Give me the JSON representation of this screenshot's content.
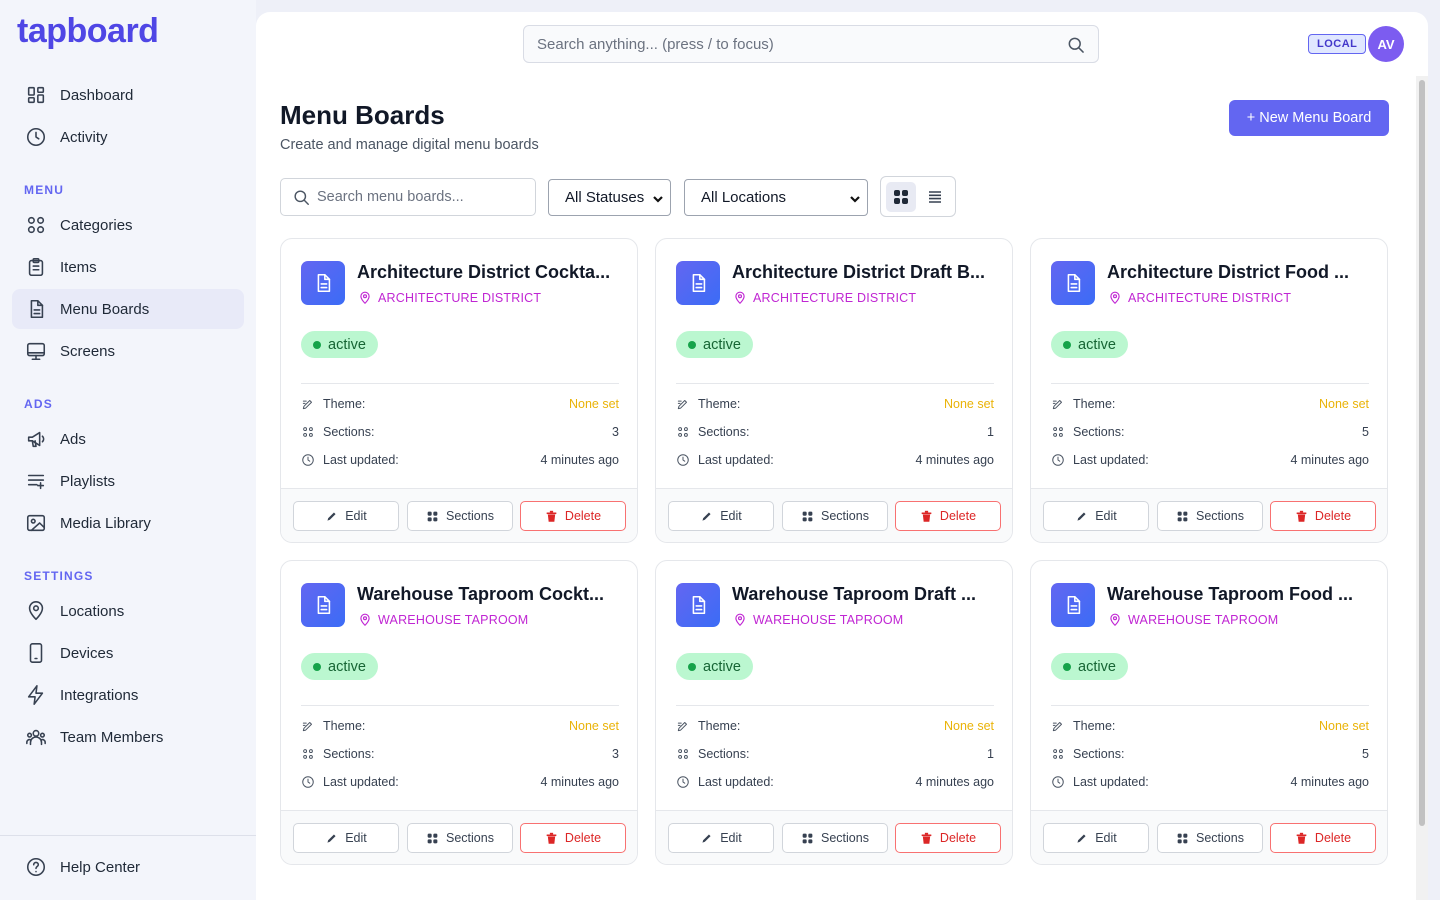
{
  "app": {
    "logo": "tapboard"
  },
  "sidebar": {
    "top_items": [
      {
        "label": "Dashboard",
        "icon": "dashboard-icon"
      },
      {
        "label": "Activity",
        "icon": "clock-icon"
      }
    ],
    "sections": [
      {
        "heading": "MENU",
        "items": [
          {
            "label": "Categories",
            "icon": "categories-icon"
          },
          {
            "label": "Items",
            "icon": "clipboard-icon"
          },
          {
            "label": "Menu Boards",
            "icon": "document-icon",
            "active": true
          },
          {
            "label": "Screens",
            "icon": "monitor-icon"
          }
        ]
      },
      {
        "heading": "ADS",
        "items": [
          {
            "label": "Ads",
            "icon": "megaphone-icon"
          },
          {
            "label": "Playlists",
            "icon": "playlist-icon"
          },
          {
            "label": "Media Library",
            "icon": "image-icon"
          }
        ]
      },
      {
        "heading": "SETTINGS",
        "items": [
          {
            "label": "Locations",
            "icon": "location-pin-icon"
          },
          {
            "label": "Devices",
            "icon": "phone-icon"
          },
          {
            "label": "Integrations",
            "icon": "lightning-icon"
          },
          {
            "label": "Team Members",
            "icon": "team-icon"
          }
        ]
      }
    ],
    "help": {
      "label": "Help Center",
      "icon": "help-icon"
    }
  },
  "header": {
    "search_placeholder": "Search anything... (press / to focus)",
    "env_badge": "LOCAL",
    "avatar_initials": "AV"
  },
  "page": {
    "title": "Menu Boards",
    "subtitle": "Create and manage digital menu boards",
    "new_button": "+ New Menu Board",
    "filter_search_placeholder": "Search menu boards...",
    "status_select": "All Statuses",
    "location_select": "All Locations",
    "view_mode": "grid"
  },
  "labels": {
    "theme": "Theme:",
    "sections": "Sections:",
    "last_updated": "Last updated:",
    "edit": "Edit",
    "sections_btn": "Sections",
    "delete": "Delete"
  },
  "boards": [
    {
      "title": "Architecture District Cockta...",
      "location": "ARCHITECTURE DISTRICT",
      "status": "active",
      "theme": "None set",
      "sections": "3",
      "updated": "4 minutes ago"
    },
    {
      "title": "Architecture District Draft B...",
      "location": "ARCHITECTURE DISTRICT",
      "status": "active",
      "theme": "None set",
      "sections": "1",
      "updated": "4 minutes ago"
    },
    {
      "title": "Architecture District Food ...",
      "location": "ARCHITECTURE DISTRICT",
      "status": "active",
      "theme": "None set",
      "sections": "5",
      "updated": "4 minutes ago"
    },
    {
      "title": "Warehouse Taproom Cockt...",
      "location": "WAREHOUSE TAPROOM",
      "status": "active",
      "theme": "None set",
      "sections": "3",
      "updated": "4 minutes ago"
    },
    {
      "title": "Warehouse Taproom Draft ...",
      "location": "WAREHOUSE TAPROOM",
      "status": "active",
      "theme": "None set",
      "sections": "1",
      "updated": "4 minutes ago"
    },
    {
      "title": "Warehouse Taproom Food ...",
      "location": "WAREHOUSE TAPROOM",
      "status": "active",
      "theme": "None set",
      "sections": "5",
      "updated": "4 minutes ago"
    }
  ],
  "colors": {
    "accent": "#6366f1",
    "logo": "#4f46e5",
    "location": "#c026d3",
    "status_bg": "#bbf7d0",
    "none_set": "#eab308",
    "delete": "#dc2626"
  }
}
